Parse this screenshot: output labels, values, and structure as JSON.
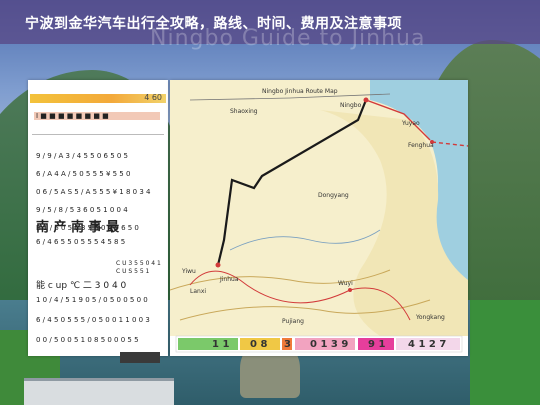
{
  "title": "宁波到金华汽车出行全攻略，路线、时间、费用及注意事项",
  "watermark": "Ningbo Guide to Jinhua",
  "left_panel": {
    "top_value": "4 60",
    "rows": [
      "9 / 9 / A 3 / 4 5 5 0 6 5 0 5",
      "6 / A 4 A / 5 0 5 5 5 ¥ 5 5 0",
      "0 6 / 5 A S 5 / A 5 5 5 ¥ 1 8 0 3 4",
      "9 / 5 / 8 / 5 3 6 0 5 1 0 0 4",
      "B 1 / 6 0 5 0 3 5 5 0 4 0 6 5 0"
    ],
    "heading": "南 产 南 事 最",
    "sub_row": "6 / 4 6 5 5 0 5 5 5 4 5 8 5",
    "label_a": "C U 3 5 5 0 4 1",
    "label_b": "C U S 5 5 1",
    "bottom_rows": [
      "能 c up   ℃   二   3 0 4 0",
      "1 0 / 4 / 5 1 9 0 5 / 0 5 0 0 5 0 0",
      "6 / 4 5 0 5 5 5 / 0 5 0 0 1 1 0 0 3",
      "0 0 / 5 0 0 5 1 0 8 5 0 0 0 5 5"
    ]
  },
  "map_panel": {
    "labels": [
      "Ningbo Jinhua Route Map",
      "Shaoxing",
      "Ningbo",
      "Yuyao",
      "Fenghua",
      "Dongyang",
      "Yiwu",
      "Jinhua",
      "Lanxi",
      "Wuyi",
      "Pujiang",
      "Yongkang"
    ],
    "legend_numbers": [
      "1 1",
      "0 8",
      "3",
      "0 1 3 9",
      "9 1",
      "4 1 2 7"
    ]
  },
  "colors": {
    "title_bar": "#58448280",
    "route_primary": "#1a1a1a",
    "route_red": "#d23a3a",
    "water": "#3d8a9e"
  }
}
